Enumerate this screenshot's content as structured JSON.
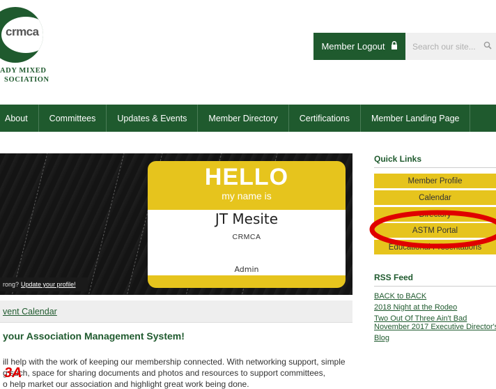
{
  "header": {
    "logo_text": "crmca",
    "logo_line_1": "ADY MIXED",
    "logo_line_2": "SOCIATION",
    "logout_label": "Member Logout",
    "lock_icon": "lock-icon",
    "search_placeholder": "Search our site...",
    "search_icon": "search-icon"
  },
  "nav": {
    "items": [
      {
        "label": "About"
      },
      {
        "label": "Committees"
      },
      {
        "label": "Updates & Events"
      },
      {
        "label": "Member Directory"
      },
      {
        "label": "Certifications"
      },
      {
        "label": "Member Landing Page"
      }
    ]
  },
  "banner": {
    "hello": "HELLO",
    "my_name_is": "my name is",
    "name": "JT Mesite",
    "org": "CRMCA",
    "role": "Admin",
    "update_prefix": "rong?",
    "update_link": "Update your profile!"
  },
  "event_calendar": "vent Calendar",
  "welcome": {
    "heading": "your Association Management System!",
    "line_1": "ill help with the work of keeping our membership connected. With networking support, simple",
    "line_2": "g  such, space for sharing documents and photos and resources to support committees,",
    "line_3": "o help market our association and highlight great work being done."
  },
  "annotation": "3A",
  "sidebar": {
    "quick_links_title": "Quick Links",
    "quick_links": [
      {
        "label": "Member Profile"
      },
      {
        "label": "Calendar"
      },
      {
        "label": "Directory"
      },
      {
        "label": "ASTM Portal"
      },
      {
        "label": "Educational Presentations"
      }
    ],
    "rss_title": "RSS Feed",
    "rss_items": [
      {
        "label": "BACK to BACK"
      },
      {
        "label": "2018 Night at the Rodeo"
      },
      {
        "label": "Two Out Of Three Ain't Bad"
      },
      {
        "label": "November 2017 Executive Director's"
      },
      {
        "label": "Blog"
      }
    ]
  },
  "colors": {
    "brand_green": "#1f5a2e",
    "gold": "#e6c41d",
    "highlight_red": "#e00000"
  }
}
